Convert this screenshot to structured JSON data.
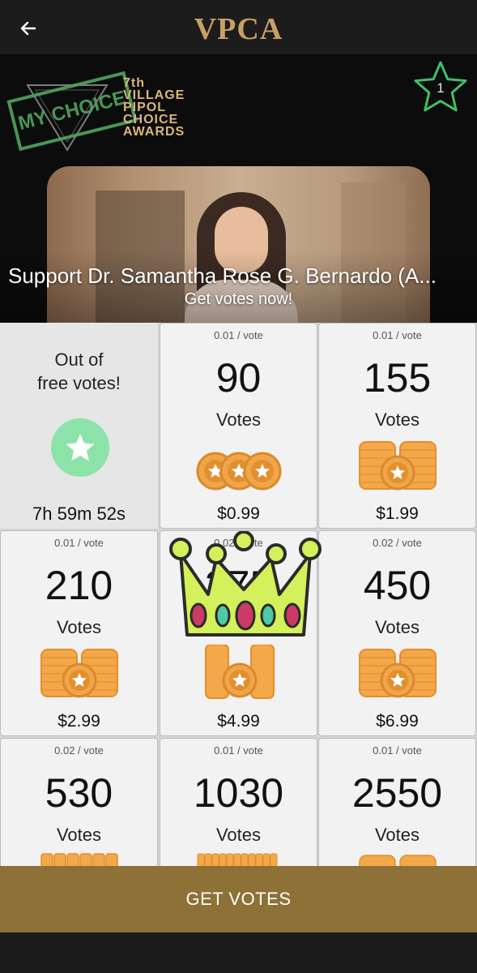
{
  "header": {
    "title": "VPCA",
    "back_icon": "arrow-left-icon"
  },
  "banner": {
    "logo_lines": [
      "7th",
      "VILLAGE",
      "PIPOL",
      "CHOICE",
      "AWARDS"
    ],
    "stamp_text": "MY CHOICE",
    "star_badge_count": "1",
    "support_text": "Support Dr. Samantha Rose G. Bernardo (A...",
    "subtitle": "Get votes now!"
  },
  "free_card": {
    "title_line1": "Out of",
    "title_line2": "free votes!",
    "timer": "7h 59m 52s",
    "icon": "star-icon",
    "accent": "#8ce3a9"
  },
  "packages": [
    {
      "rate": "0.01 / vote",
      "count": "90",
      "label": "Votes",
      "price": "$0.99"
    },
    {
      "rate": "0.01 / vote",
      "count": "155",
      "label": "Votes",
      "price": "$1.99"
    },
    {
      "rate": "0.01 / vote",
      "count": "210",
      "label": "Votes",
      "price": "$2.99"
    },
    {
      "rate": "0.02 / vote",
      "count": "275",
      "label": "Votes",
      "price": "$4.99"
    },
    {
      "rate": "0.02 / vote",
      "count": "450",
      "label": "Votes",
      "price": "$6.99"
    },
    {
      "rate": "0.02 / vote",
      "count": "530",
      "label": "Votes",
      "price": ""
    },
    {
      "rate": "0.01 / vote",
      "count": "1030",
      "label": "Votes",
      "price": ""
    },
    {
      "rate": "0.01 / vote",
      "count": "2550",
      "label": "Votes",
      "price": ""
    }
  ],
  "cta": {
    "label": "GET VOTES"
  },
  "colors": {
    "brand_gold": "#c7a067",
    "cta_bg": "#8d7137",
    "coin": "#f0a548",
    "crown": "#d4f05a"
  }
}
